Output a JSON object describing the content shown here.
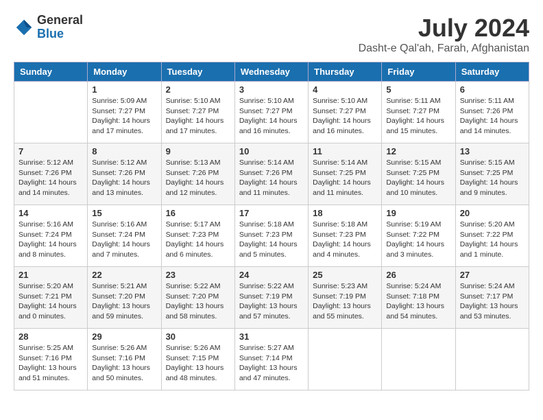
{
  "logo": {
    "general": "General",
    "blue": "Blue"
  },
  "title": {
    "month_year": "July 2024",
    "location": "Dasht-e Qal'ah, Farah, Afghanistan"
  },
  "weekdays": [
    "Sunday",
    "Monday",
    "Tuesday",
    "Wednesday",
    "Thursday",
    "Friday",
    "Saturday"
  ],
  "weeks": [
    [
      {
        "day": "",
        "info": ""
      },
      {
        "day": "1",
        "info": "Sunrise: 5:09 AM\nSunset: 7:27 PM\nDaylight: 14 hours\nand 17 minutes."
      },
      {
        "day": "2",
        "info": "Sunrise: 5:10 AM\nSunset: 7:27 PM\nDaylight: 14 hours\nand 17 minutes."
      },
      {
        "day": "3",
        "info": "Sunrise: 5:10 AM\nSunset: 7:27 PM\nDaylight: 14 hours\nand 16 minutes."
      },
      {
        "day": "4",
        "info": "Sunrise: 5:10 AM\nSunset: 7:27 PM\nDaylight: 14 hours\nand 16 minutes."
      },
      {
        "day": "5",
        "info": "Sunrise: 5:11 AM\nSunset: 7:27 PM\nDaylight: 14 hours\nand 15 minutes."
      },
      {
        "day": "6",
        "info": "Sunrise: 5:11 AM\nSunset: 7:26 PM\nDaylight: 14 hours\nand 14 minutes."
      }
    ],
    [
      {
        "day": "7",
        "info": "Sunrise: 5:12 AM\nSunset: 7:26 PM\nDaylight: 14 hours\nand 14 minutes."
      },
      {
        "day": "8",
        "info": "Sunrise: 5:12 AM\nSunset: 7:26 PM\nDaylight: 14 hours\nand 13 minutes."
      },
      {
        "day": "9",
        "info": "Sunrise: 5:13 AM\nSunset: 7:26 PM\nDaylight: 14 hours\nand 12 minutes."
      },
      {
        "day": "10",
        "info": "Sunrise: 5:14 AM\nSunset: 7:26 PM\nDaylight: 14 hours\nand 11 minutes."
      },
      {
        "day": "11",
        "info": "Sunrise: 5:14 AM\nSunset: 7:25 PM\nDaylight: 14 hours\nand 11 minutes."
      },
      {
        "day": "12",
        "info": "Sunrise: 5:15 AM\nSunset: 7:25 PM\nDaylight: 14 hours\nand 10 minutes."
      },
      {
        "day": "13",
        "info": "Sunrise: 5:15 AM\nSunset: 7:25 PM\nDaylight: 14 hours\nand 9 minutes."
      }
    ],
    [
      {
        "day": "14",
        "info": "Sunrise: 5:16 AM\nSunset: 7:24 PM\nDaylight: 14 hours\nand 8 minutes."
      },
      {
        "day": "15",
        "info": "Sunrise: 5:16 AM\nSunset: 7:24 PM\nDaylight: 14 hours\nand 7 minutes."
      },
      {
        "day": "16",
        "info": "Sunrise: 5:17 AM\nSunset: 7:23 PM\nDaylight: 14 hours\nand 6 minutes."
      },
      {
        "day": "17",
        "info": "Sunrise: 5:18 AM\nSunset: 7:23 PM\nDaylight: 14 hours\nand 5 minutes."
      },
      {
        "day": "18",
        "info": "Sunrise: 5:18 AM\nSunset: 7:23 PM\nDaylight: 14 hours\nand 4 minutes."
      },
      {
        "day": "19",
        "info": "Sunrise: 5:19 AM\nSunset: 7:22 PM\nDaylight: 14 hours\nand 3 minutes."
      },
      {
        "day": "20",
        "info": "Sunrise: 5:20 AM\nSunset: 7:22 PM\nDaylight: 14 hours\nand 1 minute."
      }
    ],
    [
      {
        "day": "21",
        "info": "Sunrise: 5:20 AM\nSunset: 7:21 PM\nDaylight: 14 hours\nand 0 minutes."
      },
      {
        "day": "22",
        "info": "Sunrise: 5:21 AM\nSunset: 7:20 PM\nDaylight: 13 hours\nand 59 minutes."
      },
      {
        "day": "23",
        "info": "Sunrise: 5:22 AM\nSunset: 7:20 PM\nDaylight: 13 hours\nand 58 minutes."
      },
      {
        "day": "24",
        "info": "Sunrise: 5:22 AM\nSunset: 7:19 PM\nDaylight: 13 hours\nand 57 minutes."
      },
      {
        "day": "25",
        "info": "Sunrise: 5:23 AM\nSunset: 7:19 PM\nDaylight: 13 hours\nand 55 minutes."
      },
      {
        "day": "26",
        "info": "Sunrise: 5:24 AM\nSunset: 7:18 PM\nDaylight: 13 hours\nand 54 minutes."
      },
      {
        "day": "27",
        "info": "Sunrise: 5:24 AM\nSunset: 7:17 PM\nDaylight: 13 hours\nand 53 minutes."
      }
    ],
    [
      {
        "day": "28",
        "info": "Sunrise: 5:25 AM\nSunset: 7:16 PM\nDaylight: 13 hours\nand 51 minutes."
      },
      {
        "day": "29",
        "info": "Sunrise: 5:26 AM\nSunset: 7:16 PM\nDaylight: 13 hours\nand 50 minutes."
      },
      {
        "day": "30",
        "info": "Sunrise: 5:26 AM\nSunset: 7:15 PM\nDaylight: 13 hours\nand 48 minutes."
      },
      {
        "day": "31",
        "info": "Sunrise: 5:27 AM\nSunset: 7:14 PM\nDaylight: 13 hours\nand 47 minutes."
      },
      {
        "day": "",
        "info": ""
      },
      {
        "day": "",
        "info": ""
      },
      {
        "day": "",
        "info": ""
      }
    ]
  ]
}
